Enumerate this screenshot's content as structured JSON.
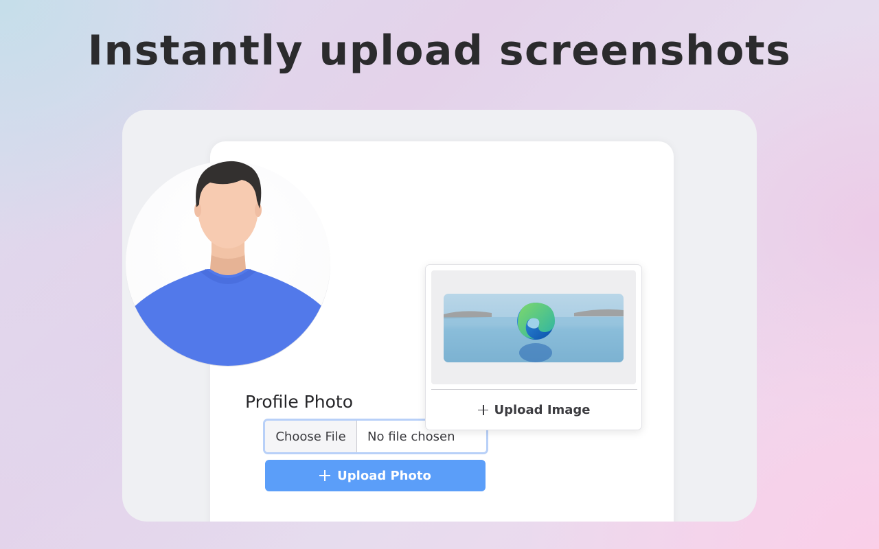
{
  "headline": "Instantly upload screenshots",
  "profile": {
    "label": "Profile Photo",
    "file_input": {
      "button_label": "Choose File",
      "status": "No file chosen"
    },
    "upload_button_label": "Upload Photo"
  },
  "popup": {
    "upload_button_label": "Upload Image"
  },
  "icons": {
    "avatar": "person-avatar-icon",
    "thumbnail": "edge-logo-icon",
    "add": "plus-icon"
  },
  "colors": {
    "primary_button": "#5b9ef9",
    "input_focus_border": "#b8d0f8",
    "headline_text": "#2b2b2d",
    "avatar_shirt": "#5279ea"
  }
}
